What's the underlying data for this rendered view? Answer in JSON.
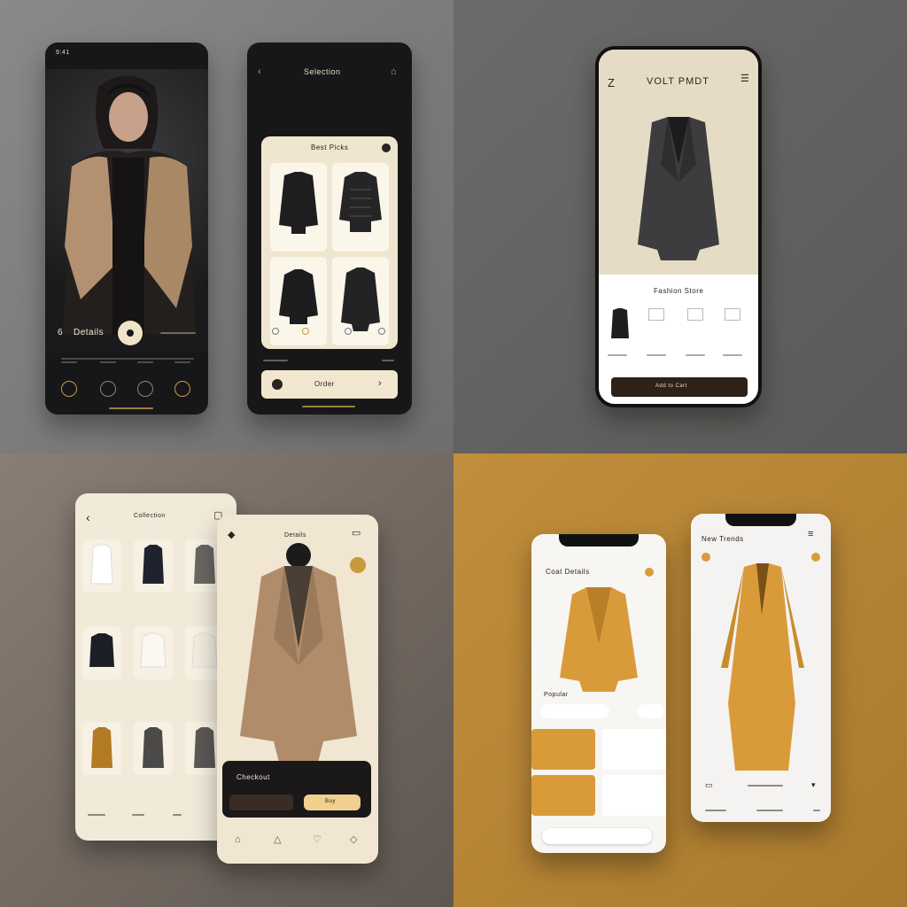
{
  "screens": {
    "q1_left": {
      "status": "9:41",
      "profile_label": "Details",
      "profile_index": "6",
      "bottom_labels": [
        "",
        "",
        "",
        ""
      ]
    },
    "q1_right": {
      "title": "Selection",
      "panel_title": "Best Picks",
      "checkout_label": "Order"
    },
    "q2": {
      "brand": "VOLT PMDT",
      "logo": "Z",
      "section_title": "Fashion Store",
      "cta_label": "Add to Cart"
    },
    "q3_left": {
      "title": "Collection"
    },
    "q3_right": {
      "title": "Details",
      "price_label": "Checkout",
      "button_label": "Buy"
    },
    "q4_left": {
      "title": "Coat Details",
      "subtitle": "Popular"
    },
    "q4_right": {
      "title": "New Trends"
    }
  },
  "colors": {
    "dark_bg": "#17171a",
    "gold": "#c89a3c",
    "cream": "#f1e9d8",
    "orange_coat": "#d99b3a",
    "camel_coat": "#b08c6a"
  },
  "icons": [
    "menu-icon",
    "back-icon",
    "cart-icon",
    "heart-icon",
    "home-icon",
    "search-icon",
    "profile-icon",
    "arrow-right-icon"
  ]
}
